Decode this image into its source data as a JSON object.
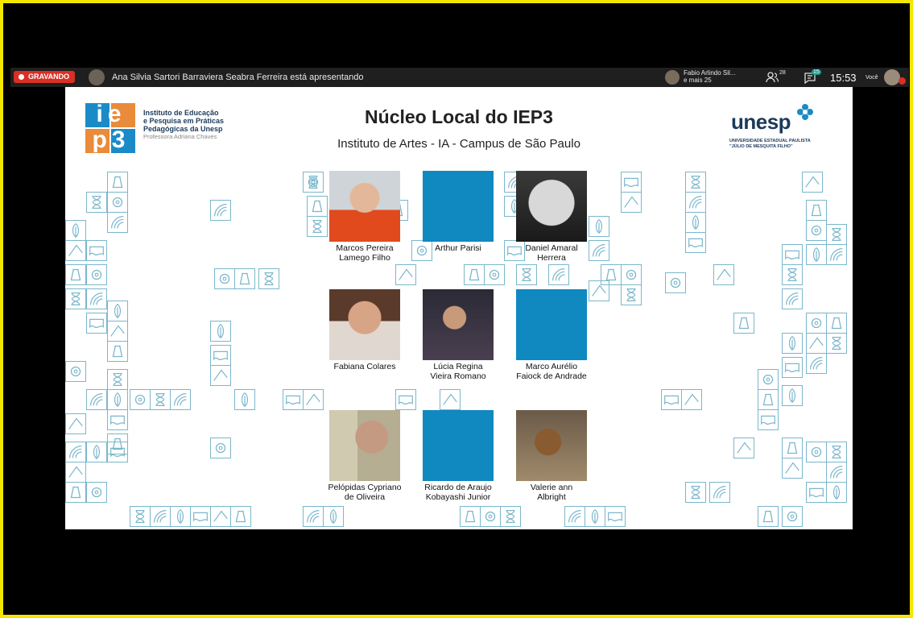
{
  "recording": {
    "label": "GRAVANDO"
  },
  "presenter": {
    "text": "Ana Silvia Sartori Barraviera Seabra Ferreira está apresentando"
  },
  "participants_summary": {
    "line1": "Fabio Arlindo Sil...",
    "line2": "e mais 25"
  },
  "people_count": "28",
  "chat_count": "15",
  "clock": "15:53",
  "self_label": "Você",
  "colors": {
    "accent_blue": "#1088c0",
    "iep3_blue": "#1b8bc7",
    "iep3_orange": "#e98b3a",
    "tile_border": "#7ab7cc",
    "recording_red": "#d93025"
  },
  "slide": {
    "iep3_logo": {
      "letters": [
        "ie",
        "p3"
      ]
    },
    "institute_lines": [
      "Instituto de Educação",
      "e Pesquisa em Práticas",
      "Pedagógicas da Unesp"
    ],
    "institute_sub": "Professora Adriana Chaves",
    "title": "Núcleo Local do IEP3",
    "subtitle": "Instituto de Artes - IA - Campus de São Paulo",
    "unesp": {
      "word": "unesp",
      "lines": [
        "UNIVERSIDADE ESTADUAL PAULISTA",
        "\"JÚLIO DE MESQUITA FILHO\""
      ]
    },
    "people": [
      {
        "name": "Marcos Pereira\nLamego Filho",
        "photo": "photo"
      },
      {
        "name": "Arthur Parisi",
        "photo": "blank"
      },
      {
        "name": "Daniel Amaral\nHerrera",
        "photo": "photo"
      },
      {
        "name": "Fabiana Colares",
        "photo": "photo"
      },
      {
        "name": "Lúcia Regina\nVieira Romano",
        "photo": "photo"
      },
      {
        "name": "Marco Aurélio\nFaiock de Andrade",
        "photo": "blank"
      },
      {
        "name": "Pelópidas Cypriano\nde Oliveira",
        "photo": "photo"
      },
      {
        "name": "Ricardo de Araujo\nKobayashi Junior",
        "photo": "blank"
      },
      {
        "name": "Valerie ann\nAlbright",
        "photo": "photo"
      }
    ]
  }
}
